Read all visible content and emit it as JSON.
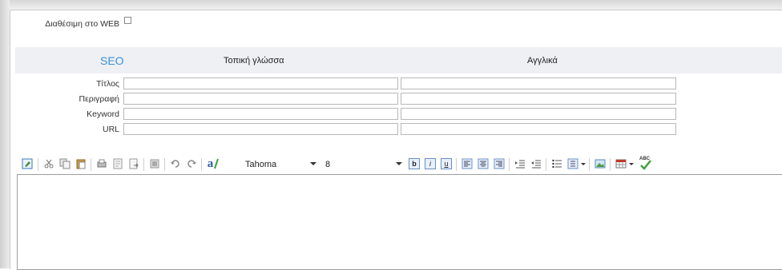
{
  "web": {
    "label": "Διαθέσιμη στο WEB",
    "checked": false
  },
  "seo": {
    "title": "SEO",
    "col_local": "Τοπική γλώσσα",
    "col_en": "Αγγλικά",
    "fields": [
      {
        "label": "Τίτλος",
        "local_value": "",
        "en_value": ""
      },
      {
        "label": "Περιγραφή",
        "local_value": "",
        "en_value": ""
      },
      {
        "label": "Keyword",
        "local_value": "",
        "en_value": ""
      },
      {
        "label": "URL",
        "local_value": "",
        "en_value": ""
      }
    ]
  },
  "toolbar": {
    "font_name": "Tahoma",
    "font_size": "8",
    "font_glyph": "a",
    "bold_glyph": "b",
    "italic_glyph": "i",
    "underline_glyph": "u",
    "spell_glyph": "ABC"
  },
  "editor": {
    "content": ""
  }
}
